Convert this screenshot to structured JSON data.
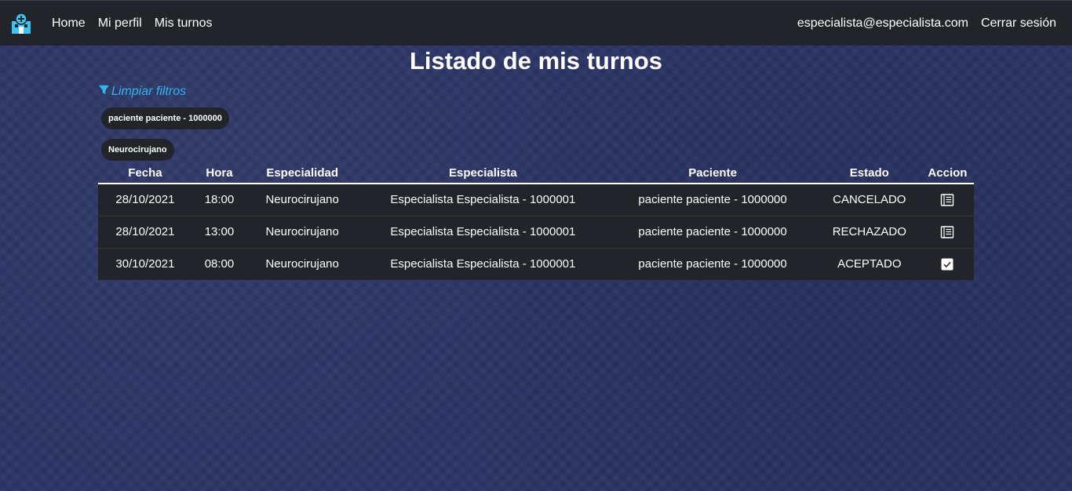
{
  "nav": {
    "brand_icon": "hospital-icon",
    "links": [
      "Home",
      "Mi perfil",
      "Mis turnos"
    ],
    "user_email": "especialista@especialista.com",
    "logout": "Cerrar sesión"
  },
  "page": {
    "title": "Listado de mis turnos",
    "clear_filters": "Limpiar filtros",
    "filter_icon": "filter-icon"
  },
  "filters": [
    "paciente paciente - 1000000",
    "Neurocirujano"
  ],
  "table": {
    "headers": [
      "Fecha",
      "Hora",
      "Especialidad",
      "Especialista",
      "Paciente",
      "Estado",
      "Accion"
    ],
    "rows": [
      {
        "fecha": "28/10/2021",
        "hora": "18:00",
        "especialidad": "Neurocirujano",
        "especialista": "Especialista Especialista - 1000001",
        "paciente": "paciente paciente - 1000000",
        "estado": "CANCELADO",
        "accion_icon": "review-icon"
      },
      {
        "fecha": "28/10/2021",
        "hora": "13:00",
        "especialidad": "Neurocirujano",
        "especialista": "Especialista Especialista - 1000001",
        "paciente": "paciente paciente - 1000000",
        "estado": "RECHAZADO",
        "accion_icon": "review-icon"
      },
      {
        "fecha": "30/10/2021",
        "hora": "08:00",
        "especialidad": "Neurocirujano",
        "especialista": "Especialista Especialista - 1000001",
        "paciente": "paciente paciente - 1000000",
        "estado": "ACEPTADO",
        "accion_icon": "check-square-icon"
      }
    ]
  },
  "colors": {
    "background": "#2b3566",
    "navbar": "#212529",
    "link_accent": "#2fb7ee",
    "brand_icon": "#3fc3f0"
  }
}
